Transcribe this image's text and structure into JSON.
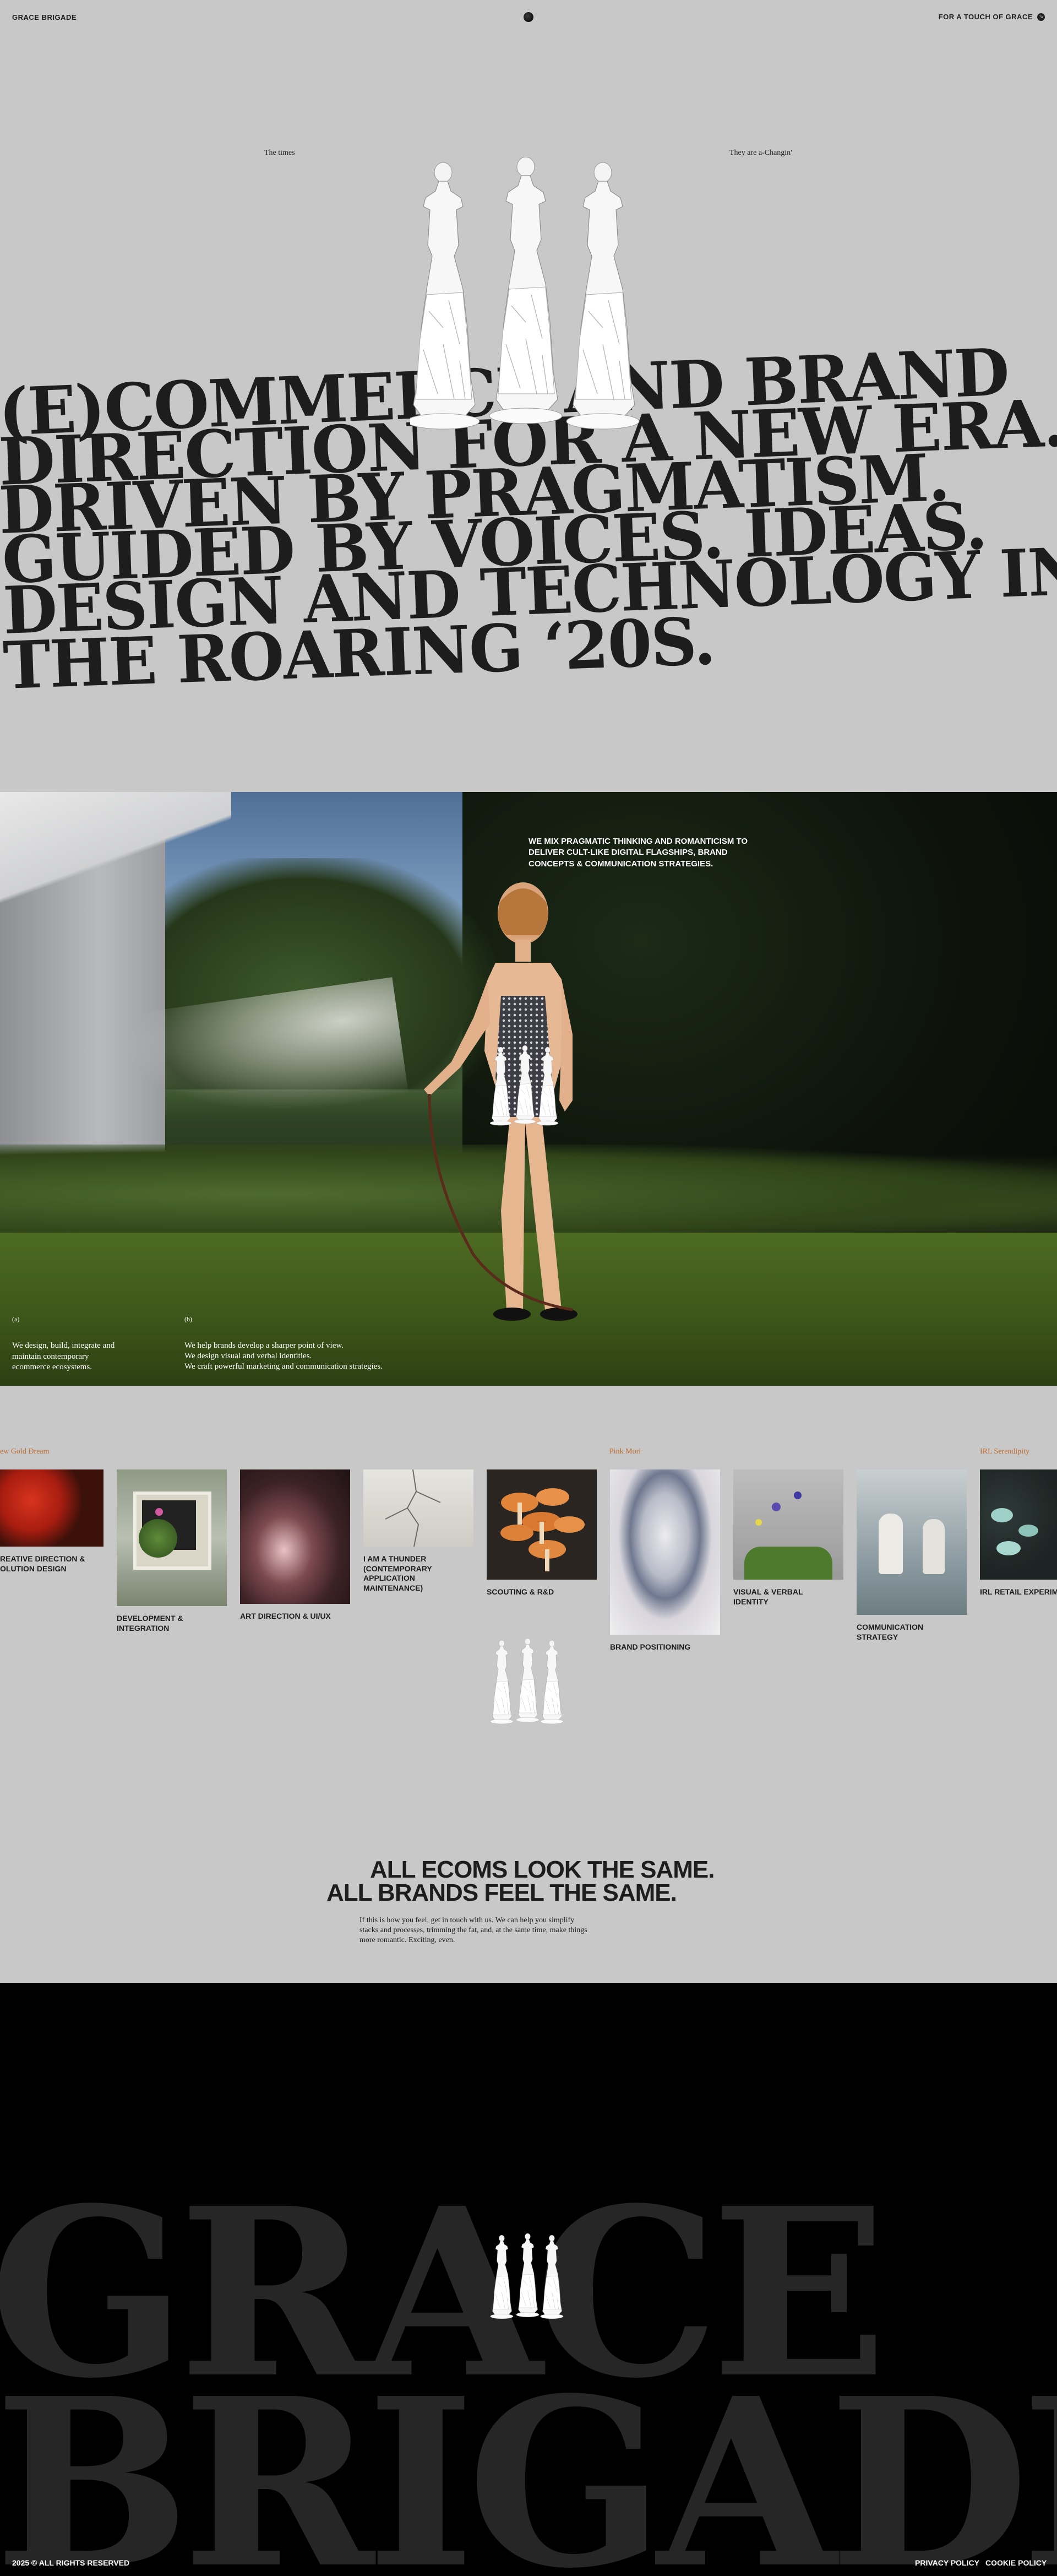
{
  "header": {
    "brand": "GRACE BRIGADE",
    "cta": "FOR A TOUCH OF GRACE",
    "cta_icon": "arrow-icon"
  },
  "hero": {
    "left_caption": "The times",
    "right_caption": "They are a-Changin'",
    "lines": [
      "(E)COMMERCE AND BRAND",
      "DIRECTION FOR A NEW ERA.",
      "DRIVEN BY PRAGMATISM.",
      "GUIDED BY VOICES. IDEAS.",
      "DESIGN AND TECHNOLOGY IN",
      "THE ROARING ‘20S."
    ]
  },
  "intro": {
    "headline": "WE MIX PRAGMATIC THINKING AND ROMANTICISM TO DELIVER CULT-LIKE DIGITAL FLAGSHIPS, BRAND CONCEPTS & COMMUNICATION STRATEGIES.",
    "col_a": {
      "marker": "(a)",
      "text": "We design, build, integrate and maintain contemporary ecommerce ecosystems."
    },
    "col_b": {
      "marker": "(b)",
      "lines": [
        "We help brands develop a sharper point of view.",
        "We design visual and verbal identities.",
        "We craft powerful marketing and communication strategies."
      ]
    }
  },
  "services": {
    "group_labels": [
      "ew Gold Dream",
      "Pink Mori",
      "IRL Serendipity"
    ],
    "items": [
      {
        "label": "REATIVE DIRECTION & OLUTION DESIGN"
      },
      {
        "label": "DEVELOPMENT & INTEGRATION"
      },
      {
        "label": "ART DIRECTION & UI/UX"
      },
      {
        "label": "I AM A THUNDER (CONTEMPORARY APPLICATION MAINTENANCE)"
      },
      {
        "label": "SCOUTING & R&D"
      },
      {
        "label": "BRAND POSITIONING"
      },
      {
        "label": "VISUAL & VERBAL IDENTITY"
      },
      {
        "label": "COMMUNICATION STRATEGY"
      },
      {
        "label": "IRL RETAIL EXPERIME"
      }
    ]
  },
  "statement": {
    "line1": "ALL ECOMS LOOK THE SAME.",
    "line2": "ALL BRANDS FEEL THE SAME.",
    "body": "If this is how you feel, get in touch with us. We can help you simplify stacks and processes, trimming the fat, and, at the same time, make things more romantic. Exciting, even."
  },
  "footer": {
    "giant_1": "GRACE",
    "giant_2": "BRIGADE",
    "copyright": "2025 © ALL RIGHTS RESERVED",
    "privacy": "PRIVACY POLICY",
    "cookie": "COOKIE POLICY"
  }
}
